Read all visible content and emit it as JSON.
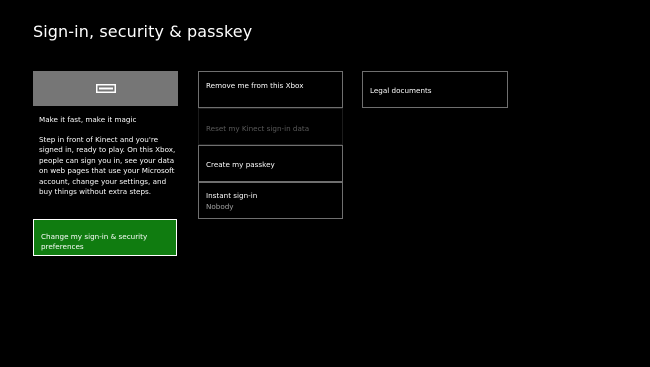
{
  "header": {
    "title": "Sign-in, security & passkey"
  },
  "hero": {
    "icon": "kinect-sensor-icon",
    "tile_color": "#767676",
    "heading": "Make it fast, make it magic",
    "body": "Step in front of Kinect and you're signed in, ready to play. On this Xbox, people can sign you in, see your data on web pages that use your Microsoft account, change your settings, and buy things without extra steps.",
    "button_label": "Change my sign-in & security preferences",
    "button_color": "#107c10"
  },
  "options": {
    "remove_label": "Remove me from this Xbox",
    "reset_label": "Reset my Kinect sign-in data",
    "passkey_label": "Create my passkey",
    "instant_label": "Instant sign-in",
    "instant_value": "Nobody"
  },
  "legal": {
    "label": "Legal documents"
  }
}
